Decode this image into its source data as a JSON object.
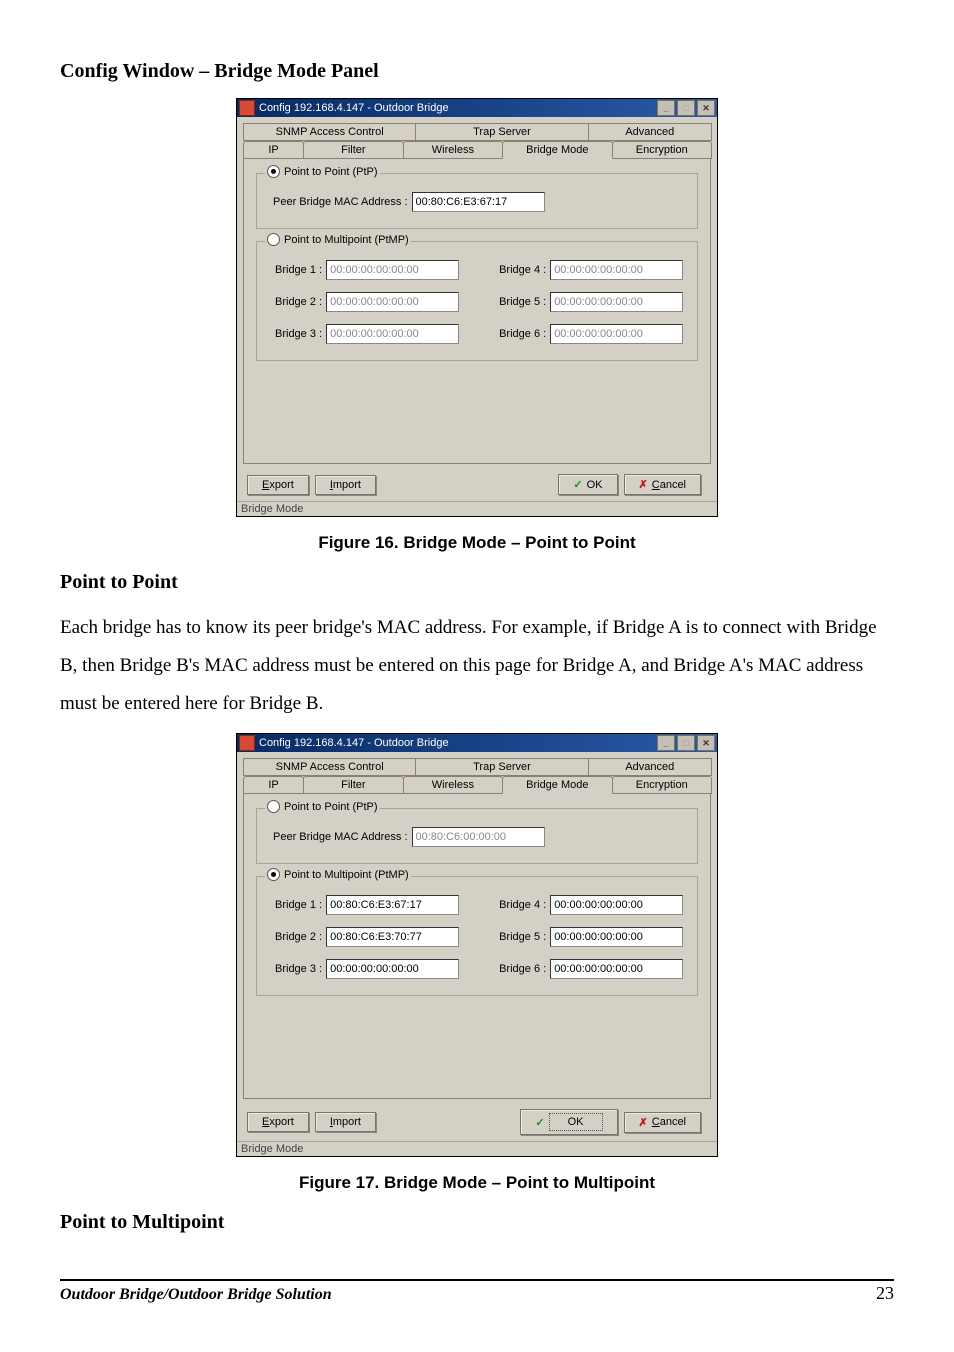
{
  "headings": {
    "config_window": "Config Window – Bridge Mode Panel",
    "point_to_point": "Point to Point",
    "point_to_multipoint": "Point to Multipoint"
  },
  "paragraphs": {
    "ptp_desc": "Each bridge has to know its peer bridge's MAC address.  For example, if Bridge A is to connect with Bridge B, then Bridge B's MAC address must be entered on this page for Bridge A, and Bridge A's MAC address must be entered here for Bridge B."
  },
  "figures": {
    "fig16": "Figure 16.  Bridge Mode – Point to Point",
    "fig17": "Figure 17.  Bridge Mode – Point to Multipoint"
  },
  "dialog_common": {
    "title": "Config 192.168.4.147 - Outdoor Bridge",
    "tabs_row1": [
      "SNMP Access Control",
      "Trap Server",
      "Advanced"
    ],
    "tabs_row2": [
      "IP",
      "Filter",
      "Wireless",
      "Bridge Mode",
      "Encryption"
    ],
    "group_ptp_label": "Point to Point (PtP)",
    "group_ptmp_label": "Point to Multipoint (PtMP)",
    "peer_label": "Peer Bridge MAC Address :",
    "bridge_labels": [
      "Bridge 1 :",
      "Bridge 2 :",
      "Bridge 3 :",
      "Bridge 4 :",
      "Bridge 5 :",
      "Bridge 6 :"
    ],
    "btn_export": "Export",
    "btn_export_u": "E",
    "btn_import": "Import",
    "btn_import_u": "I",
    "btn_ok": "OK",
    "btn_cancel": "Cancel",
    "btn_cancel_u": "C",
    "status": "Bridge Mode"
  },
  "dialog1": {
    "mode_ptp_selected": true,
    "peer_value": "00:80:C6:E3:67:17",
    "bridge_values": [
      "00:00:00:00:00:00",
      "00:00:00:00:00:00",
      "00:00:00:00:00:00",
      "00:00:00:00:00:00",
      "00:00:00:00:00:00",
      "00:00:00:00:00:00"
    ]
  },
  "dialog2": {
    "mode_ptp_selected": false,
    "peer_value": "00:80:C6:00:00:00",
    "bridge_values": [
      "00:80:C6:E3:67:17",
      "00:80:C6:E3:70:77",
      "00:00:00:00:00:00",
      "00:00:00:00:00:00",
      "00:00:00:00:00:00",
      "00:00:00:00:00:00"
    ]
  },
  "footer": {
    "left": "Outdoor Bridge/Outdoor Bridge Solution",
    "right": "23"
  }
}
